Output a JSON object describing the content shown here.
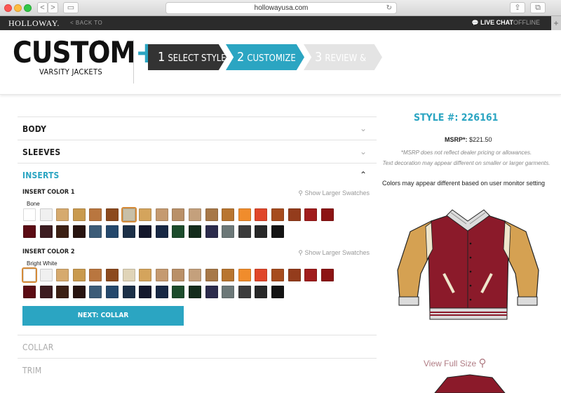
{
  "browser": {
    "url": "hollowayusa.com",
    "back_glyph": "<",
    "forward_glyph": ">",
    "sidebar_glyph": "▭",
    "share_glyph": "⇪",
    "tabs_glyph": "⧉",
    "reload_glyph": "↻",
    "newtab_glyph": "+"
  },
  "site_bar": {
    "logo": "HOLLOWAY.",
    "back_link": "< BACK TO",
    "live_chat": "LIVE CHAT",
    "status": "OFFLINE",
    "chat_icon_glyph": "💬"
  },
  "brand": {
    "main_prefix": "CUSTOM",
    "main_plus": "+",
    "tm": "TM",
    "sub": "VARSITY JACKETS"
  },
  "steps": [
    {
      "num": "1",
      "label": "SELECT STYLE"
    },
    {
      "num": "2",
      "label": "CUSTOMIZE"
    },
    {
      "num": "3",
      "label": "REVIEW & SAVE"
    }
  ],
  "accordion": {
    "body": "BODY",
    "sleeves": "SLEEVES",
    "inserts": "INSERTS",
    "collar": "COLLAR",
    "trim": "TRIM",
    "chev_down": "⌄",
    "chev_up": "⌃"
  },
  "insert1": {
    "title": "INSERT COLOR 1",
    "link": "Show Larger Swatches",
    "selected_name": "Bone"
  },
  "insert2": {
    "title": "INSERT COLOR 2",
    "link": "Show Larger Swatches",
    "selected_name": "Bright White"
  },
  "swatches1_row1": [
    "#ffffff",
    "#f0f0f0",
    "#d6aa6e",
    "#c99a4e",
    "#b9763f",
    "#8c4a1e",
    "#c8c0a8",
    "#d4a45c",
    "#c59a70",
    "#b99068",
    "#c4a07c",
    "#a77848",
    "#b87530",
    "#f08c2c",
    "#e0462a",
    "#a64c1e",
    "#943c1c",
    "#a01c1c",
    "#8c1414"
  ],
  "swatches1_row2": [
    "#5c0c14",
    "#3c1c20",
    "#3c2014",
    "#281410",
    "#3c5c78",
    "#24486c",
    "#1c3048",
    "#14182c",
    "#182844",
    "#1c4c2c",
    "#142c1c",
    "#2c2c4c",
    "#6c7878",
    "#3c3c3c",
    "#282828",
    "#141414"
  ],
  "swatches2_row1": [
    "#ffffff",
    "#f0f0f0",
    "#d6aa6e",
    "#c99a4e",
    "#b9763f",
    "#8c4a1e",
    "#e0d4b8",
    "#d4a45c",
    "#c59a70",
    "#b99068",
    "#c4a07c",
    "#a77848",
    "#b87530",
    "#f08c2c",
    "#e0462a",
    "#a64c1e",
    "#943c1c",
    "#a01c1c",
    "#8c1414"
  ],
  "swatches2_row2": [
    "#5c0c14",
    "#3c1c20",
    "#3c2014",
    "#281410",
    "#3c5c78",
    "#24486c",
    "#1c3048",
    "#14182c",
    "#182844",
    "#1c4c2c",
    "#142c1c",
    "#2c2c4c",
    "#6c7878",
    "#3c3c3c",
    "#282828",
    "#141414"
  ],
  "next_button": "NEXT: COLLAR",
  "right": {
    "style_label": "STYLE #: 226161",
    "msrp_label": "MSRP*:",
    "msrp_value": "$221.50",
    "note1": "*MSRP does not reflect dealer pricing or allowances.",
    "note2": "Text decoration may appear different on smaller or larger garments.",
    "colors_note": "Colors may appear different based on user monitor setting",
    "view_full": "View Full Size",
    "search_glyph": "⚲"
  },
  "colors": {
    "accent": "#2ba5c2",
    "body": "#8b1a2a",
    "sleeves": "#d5a152",
    "inserts": "#efe6cc"
  }
}
